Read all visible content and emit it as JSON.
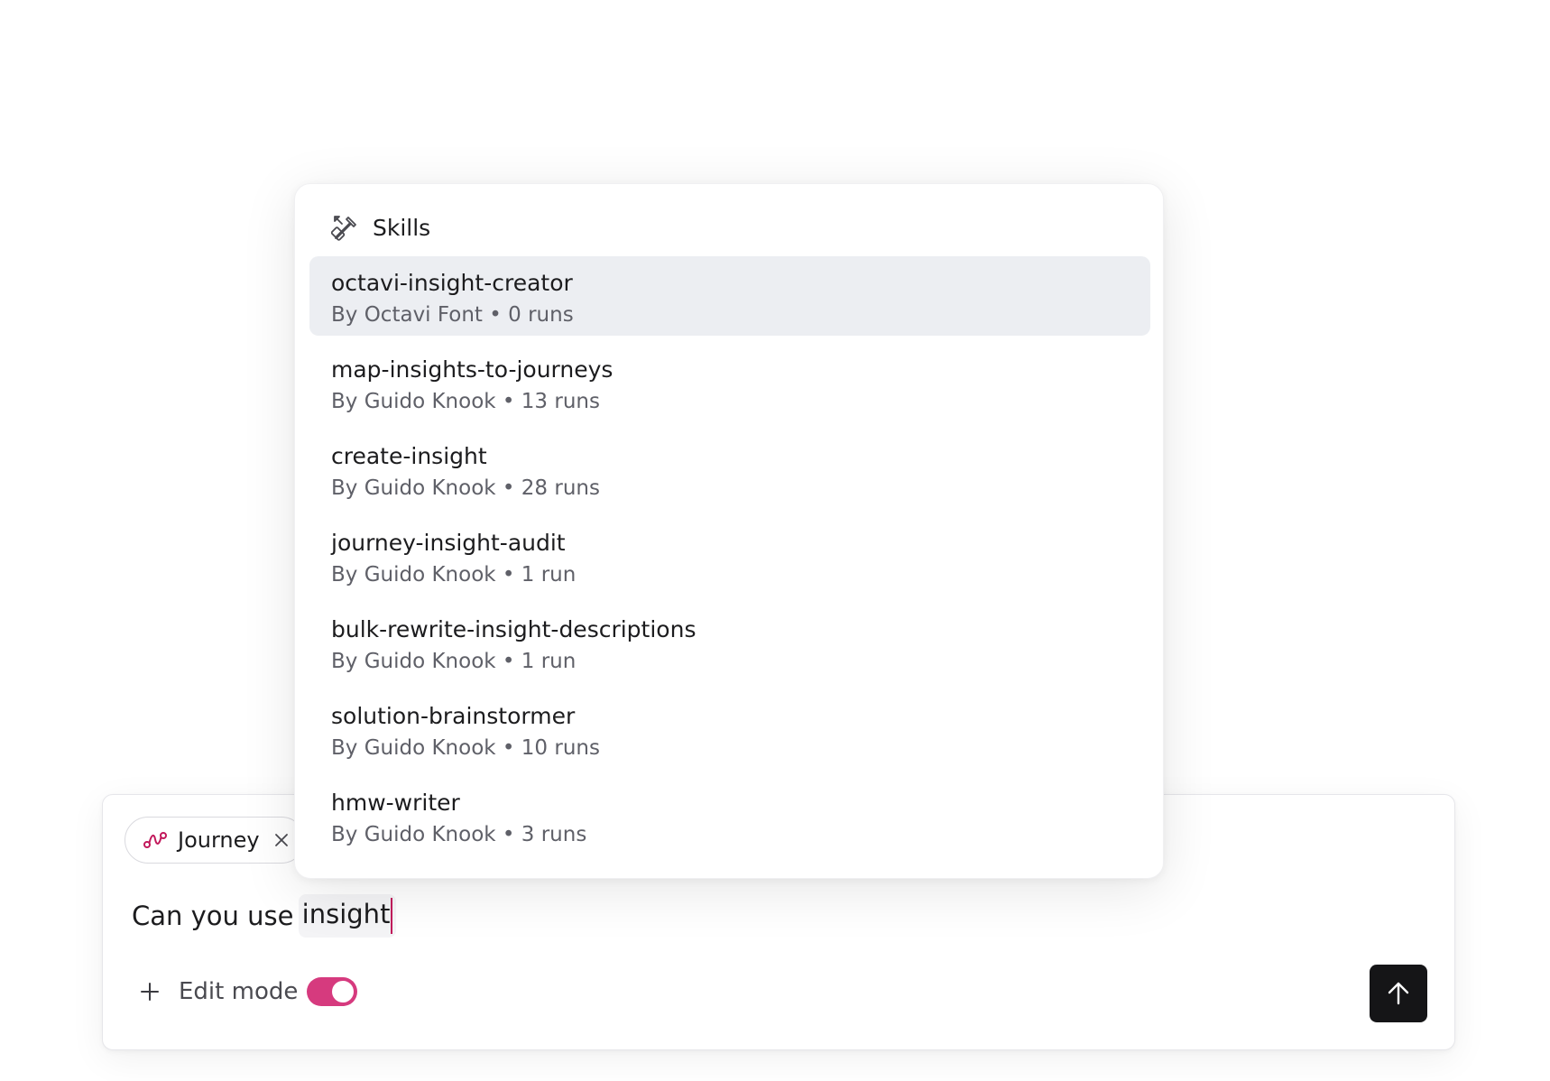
{
  "composer": {
    "chip": {
      "label": "Journey",
      "icon": "journey-icon"
    },
    "input": {
      "prefix": "Can you use ",
      "query": "insight"
    },
    "edit_mode_label": "Edit mode",
    "edit_mode_on": true
  },
  "skills_popup": {
    "title": "Skills",
    "items": [
      {
        "name": "octavi-insight-creator",
        "meta": "By Octavi Font • 0 runs",
        "selected": true
      },
      {
        "name": "map-insights-to-journeys",
        "meta": "By Guido Knook • 13 runs",
        "selected": false
      },
      {
        "name": "create-insight",
        "meta": "By Guido Knook • 28 runs",
        "selected": false
      },
      {
        "name": "journey-insight-audit",
        "meta": "By Guido Knook • 1 run",
        "selected": false
      },
      {
        "name": "bulk-rewrite-insight-descriptions",
        "meta": "By Guido Knook • 1 run",
        "selected": false
      },
      {
        "name": "solution-brainstormer",
        "meta": "By Guido Knook • 10 runs",
        "selected": false
      },
      {
        "name": "hmw-writer",
        "meta": "By Guido Knook • 3 runs",
        "selected": false
      }
    ]
  },
  "colors": {
    "accent": "#d63a7e",
    "journey_icon": "#c2185b",
    "send_button": "#151517",
    "selected_row": "#eceef2"
  }
}
